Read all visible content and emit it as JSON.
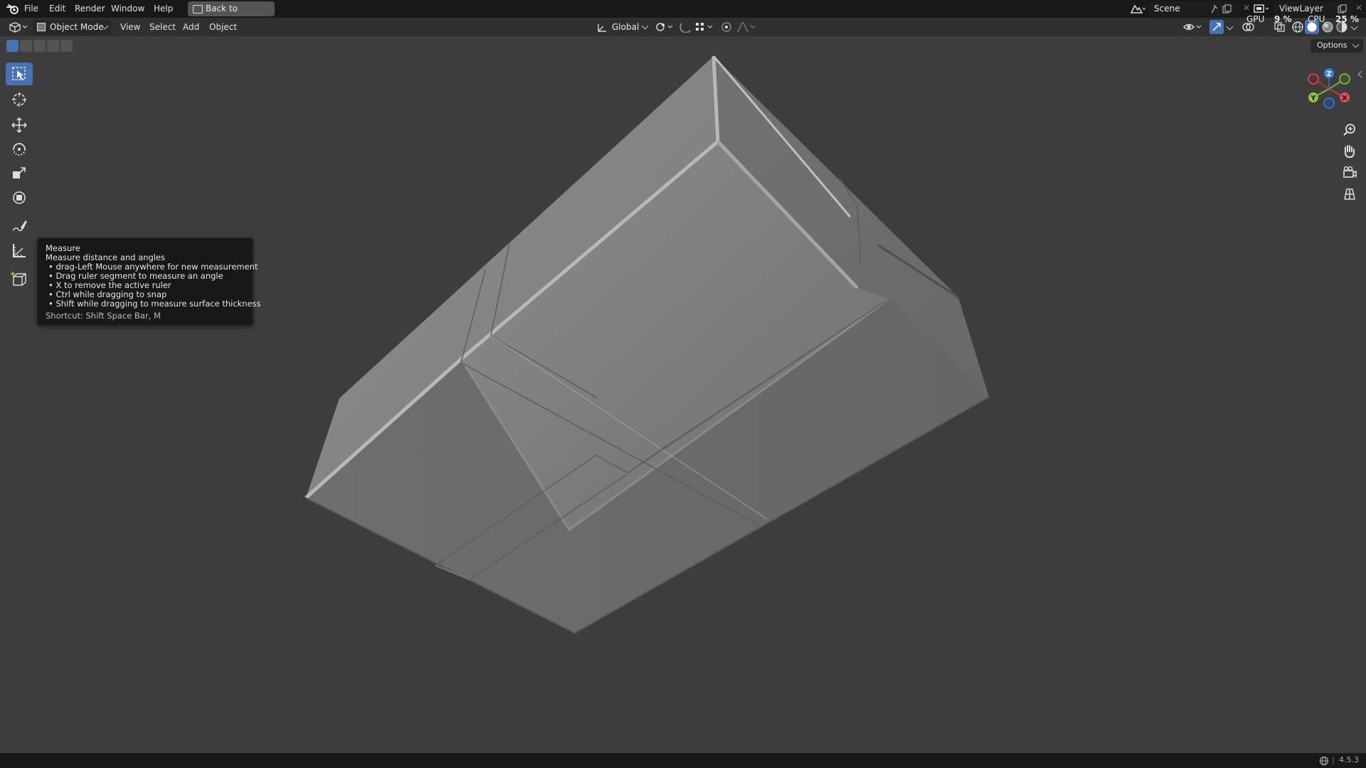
{
  "topbar": {
    "menus": [
      "File",
      "Edit",
      "Render",
      "Window",
      "Help"
    ],
    "back_button": "Back to Previous",
    "scene": "Scene",
    "view_layer": "ViewLayer",
    "gpu_label": "GPU",
    "gpu_value": "9 %",
    "cpu_label": "CPU",
    "cpu_value": "25 %"
  },
  "header": {
    "mode": "Object Mode",
    "menus": [
      "View",
      "Select",
      "Add",
      "Object"
    ],
    "transform_orientation": "Global",
    "options": "Options"
  },
  "toolbar": {
    "tools": [
      "select-box",
      "cursor",
      "move",
      "rotate",
      "scale",
      "transform",
      "annotate",
      "measure",
      "add-cube"
    ],
    "active_tool": "select-box"
  },
  "tooltip": {
    "title": "Measure",
    "description": "Measure distance and angles",
    "bullets": [
      "• drag-Left Mouse anywhere for new measurement",
      "• Drag ruler segment to measure an angle",
      "• X to remove the active ruler",
      "• Ctrl while dragging to snap",
      "• Shift while dragging to measure surface thickness"
    ],
    "shortcut": "Shortcut: Shift Space Bar, M"
  },
  "gizmo": {
    "axes": [
      "Z",
      "Y",
      "X"
    ],
    "colors": {
      "x": "#e8485a",
      "y": "#8bc93c",
      "z": "#2f83e0"
    }
  },
  "status": {
    "version": "4.5.3"
  },
  "colors": {
    "accent": "#4772b3",
    "viewport_bg": "#3d3d3d",
    "header_bg": "#303030",
    "topbar_bg": "#181818"
  }
}
